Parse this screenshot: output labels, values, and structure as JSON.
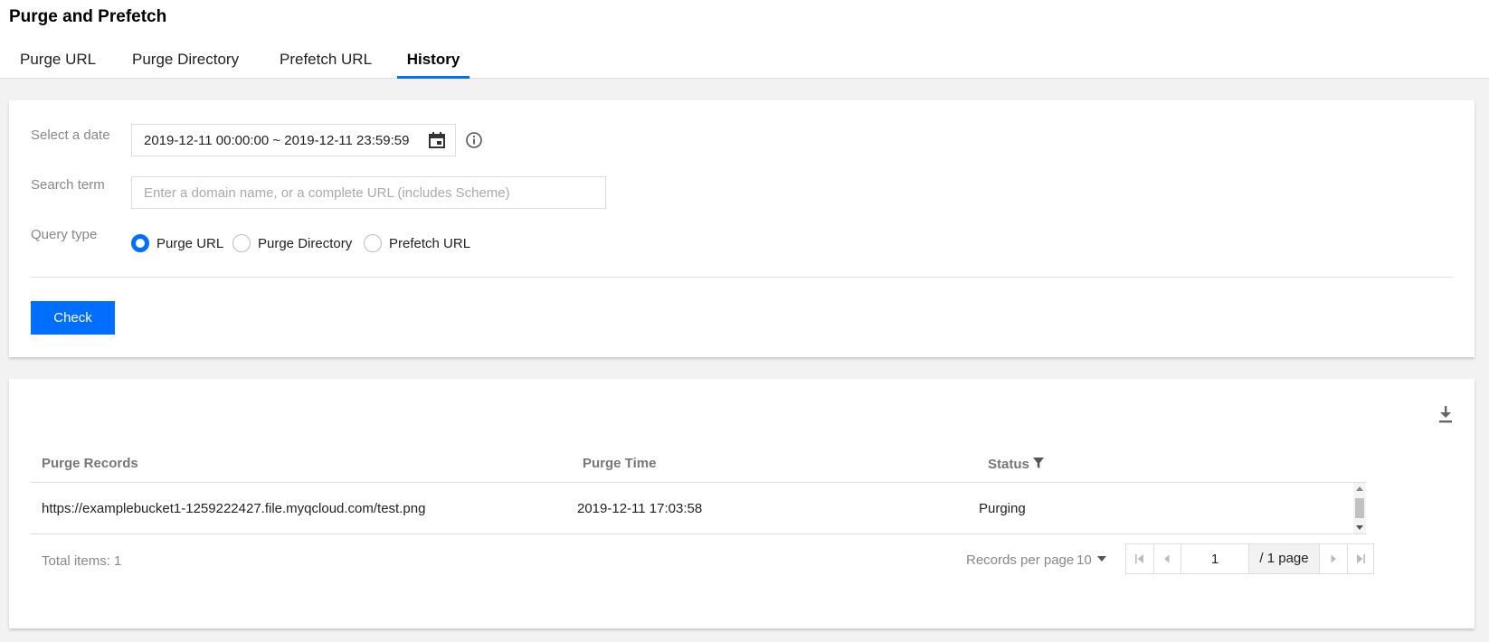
{
  "header": {
    "title": "Purge and Prefetch",
    "tabs": [
      {
        "label": "Purge URL",
        "active": false
      },
      {
        "label": "Purge Directory",
        "active": false
      },
      {
        "label": "Prefetch URL",
        "active": false
      },
      {
        "label": "History",
        "active": true
      }
    ]
  },
  "filter": {
    "date_label": "Select a date",
    "date_value": "2019-12-11 00:00:00 ~ 2019-12-11 23:59:59",
    "search_label": "Search term",
    "search_placeholder": "Enter a domain name, or a complete URL (includes Scheme)",
    "search_value": "",
    "query_label": "Query type",
    "query_options": [
      "Purge URL",
      "Purge Directory",
      "Prefetch URL"
    ],
    "query_selected": "Purge URL",
    "check_label": "Check"
  },
  "table": {
    "columns": [
      "Purge Records",
      "Purge Time",
      "Status"
    ],
    "rows": [
      {
        "record": "https://examplebucket1-1259222427.file.myqcloud.com/test.png",
        "time": "2019-12-11 17:03:58",
        "status": "Purging"
      }
    ]
  },
  "pagination": {
    "total_text": "Total items:  1",
    "records_per_page_label": "Records per page",
    "records_per_page": "10",
    "current_page": "1",
    "total_pages_text": "/ 1 page"
  },
  "colors": {
    "accent": "#006eff",
    "background": "#f2f2f2"
  },
  "icons": [
    "calendar-icon",
    "info-icon",
    "download-icon",
    "filter-icon",
    "first-page-icon",
    "prev-page-icon",
    "next-page-icon",
    "last-page-icon"
  ]
}
